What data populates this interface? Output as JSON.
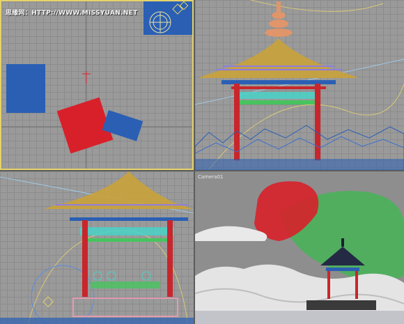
{
  "watermark": {
    "text": "思缘网：HTTP://WWW.MISSYUAN.NET"
  },
  "viewports": {
    "top": {
      "label": ""
    },
    "front": {
      "label": ""
    },
    "left": {
      "label": ""
    },
    "camera": {
      "label": "Camera01"
    }
  },
  "colors": {
    "active_border": "#e6d36a",
    "grid": "#8c8c8c",
    "blue_object": "#2a5fb4",
    "red_object": "#d8202a",
    "roof_gold": "#c9a23a",
    "cyan_detail": "#49d2c8",
    "red_pillar": "#c8262c",
    "green_detail": "#47c45f",
    "terrain_white": "#e9e9e9"
  }
}
